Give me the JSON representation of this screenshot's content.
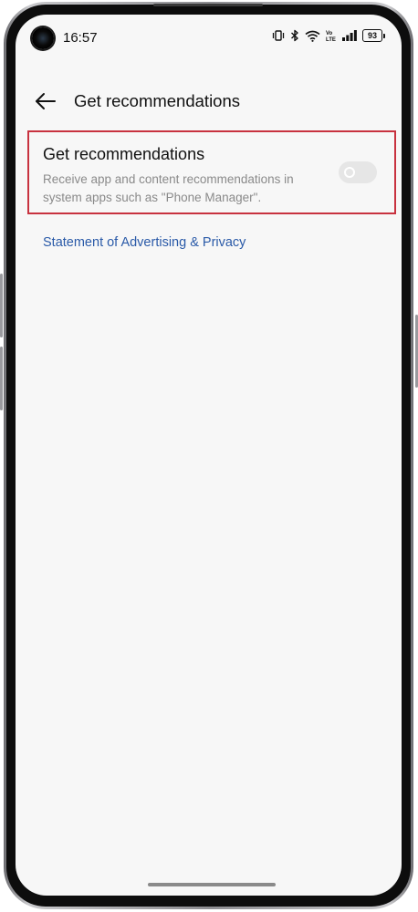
{
  "status_bar": {
    "time": "16:57",
    "battery_level": "93",
    "icons": [
      "vibrate-icon",
      "bluetooth-icon",
      "wifi-icon",
      "volte-icon",
      "signal-icon",
      "battery-icon"
    ]
  },
  "toolbar": {
    "back_icon": "arrow-left-icon",
    "title": "Get recommendations"
  },
  "setting": {
    "title": "Get recommendations",
    "description": "Receive app and content recommendations in system apps such as \"Phone Manager\".",
    "toggle_on": false
  },
  "links": {
    "privacy": "Statement of Advertising & Privacy"
  },
  "colors": {
    "highlight_border": "#c8323f",
    "link": "#2a5aa8",
    "background": "#f7f7f7"
  }
}
